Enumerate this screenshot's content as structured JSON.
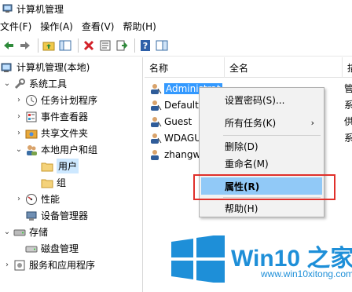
{
  "window": {
    "title": "计算机管理"
  },
  "menubar": [
    "文件(F)",
    "操作(A)",
    "查看(V)",
    "帮助(H)"
  ],
  "tree": [
    {
      "label": "计算机管理(本地)",
      "name": "tree-node-computer-management",
      "icon": "computer-management-icon",
      "exp": ""
    },
    {
      "label": "系统工具",
      "name": "tree-node-system-tools",
      "icon": "tools-icon",
      "exp": "⌄"
    },
    {
      "label": "任务计划程序",
      "name": "tree-node-task-scheduler",
      "icon": "clock-icon",
      "exp": "›"
    },
    {
      "label": "事件查看器",
      "name": "tree-node-event-viewer",
      "icon": "event-viewer-icon",
      "exp": "›"
    },
    {
      "label": "共享文件夹",
      "name": "tree-node-shared-folders",
      "icon": "shared-folder-icon",
      "exp": "›"
    },
    {
      "label": "本地用户和组",
      "name": "tree-node-local-users-groups",
      "icon": "users-icon",
      "exp": "⌄"
    },
    {
      "label": "用户",
      "name": "tree-node-users",
      "icon": "folder-icon",
      "exp": ""
    },
    {
      "label": "组",
      "name": "tree-node-groups",
      "icon": "folder-icon",
      "exp": ""
    },
    {
      "label": "性能",
      "name": "tree-node-performance",
      "icon": "performance-icon",
      "exp": "›"
    },
    {
      "label": "设备管理器",
      "name": "tree-node-device-manager",
      "icon": "device-manager-icon",
      "exp": ""
    },
    {
      "label": "存储",
      "name": "tree-node-storage",
      "icon": "storage-icon",
      "exp": "⌄"
    },
    {
      "label": "磁盘管理",
      "name": "tree-node-disk-management",
      "icon": "disk-icon",
      "exp": ""
    },
    {
      "label": "服务和应用程序",
      "name": "tree-node-services-apps",
      "icon": "services-icon",
      "exp": "›"
    }
  ],
  "list": {
    "columns": [
      "名称",
      "全名",
      "描"
    ],
    "rows": [
      {
        "name": "Administrat",
        "desc": "管"
      },
      {
        "name": "DefaultA",
        "desc": "系"
      },
      {
        "name": "Guest",
        "desc": "供"
      },
      {
        "name": "WDAGU",
        "desc": "系"
      },
      {
        "name": "zhangw",
        "desc": ""
      }
    ]
  },
  "context_menu": [
    {
      "label": "设置密码(S)...",
      "name": "ctx-set-password"
    },
    {
      "label": "所有任务(K)",
      "name": "ctx-all-tasks",
      "arrow": "›"
    },
    {
      "label": "删除(D)",
      "name": "ctx-delete"
    },
    {
      "label": "重命名(M)",
      "name": "ctx-rename"
    },
    {
      "label": "属性(R)",
      "name": "ctx-properties"
    },
    {
      "label": "帮助(H)",
      "name": "ctx-help"
    }
  ],
  "watermark": {
    "title": "Win10 之家",
    "url": "www.win10xitong.com"
  }
}
